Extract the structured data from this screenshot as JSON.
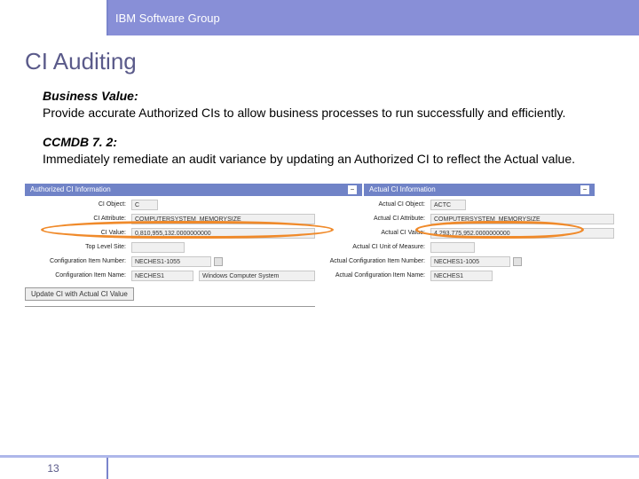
{
  "header": {
    "group": "IBM Software Group"
  },
  "title": "CI Auditing",
  "sections": {
    "bv_label": "Business Value:",
    "bv_text": "Provide accurate Authorized CIs to allow business processes to run successfully and efficiently.",
    "cc_label": "CCMDB 7. 2:",
    "cc_text": "Immediately remediate an audit variance by updating an Authorized CI to reflect the Actual value."
  },
  "shot": {
    "left_header": "Authorized CI Information",
    "right_header": "Actual CI Information",
    "left_rows": {
      "r1l": "CI Object:",
      "r1v": "C",
      "r2l": "CI Attribute:",
      "r2v": "COMPUTERSYSTEM_MEMORYSIZE",
      "r3l": "CI Value:",
      "r3v": "0,810,955,132.0000000000",
      "r4l": "Top Level Site:",
      "r4v": "",
      "r5l": "Configuration Item Number:",
      "r5v": "NECHES1-1055",
      "r6l": "Configuration Item Name:",
      "r6v": "NECHES1",
      "r6extra": "Windows Computer System"
    },
    "right_rows": {
      "r1l": "Actual CI Object:",
      "r1v": "ACTC",
      "r2l": "Actual CI Attribute:",
      "r2v": "COMPUTERSYSTEM_MEMORYSIZE",
      "r3l": "Actual CI Value:",
      "r3v": "4,293,775,952.0000000000",
      "r4l": "Actual CI Unit of Measure:",
      "r4v": "",
      "r5l": "Actual Configuration Item Number:",
      "r5v": "NECHES1-1005",
      "r6l": "Actual Configuration Item Name:",
      "r6v": "NECHES1"
    },
    "button": "Update CI with Actual CI Value"
  },
  "page_number": "13"
}
